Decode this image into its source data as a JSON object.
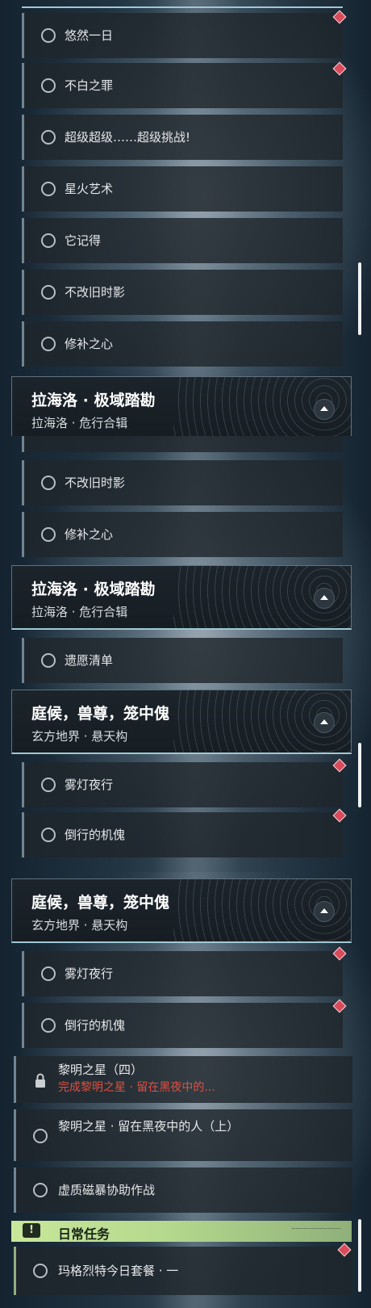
{
  "panel1": {
    "items": [
      "悠然一日",
      "不白之罪",
      "超级超级……超级挑战!",
      "星火艺术",
      "它记得",
      "不改旧时影",
      "修补之心"
    ],
    "header": {
      "title": "拉海洛 · 极域踏勘",
      "subtitle": "拉海洛 · 危行合辑"
    }
  },
  "panel2": {
    "items_top": [
      "不改旧时影",
      "修补之心"
    ],
    "header1": {
      "title": "拉海洛 · 极域踏勘",
      "subtitle": "拉海洛 · 危行合辑"
    },
    "item_mid": "遗愿清单",
    "header2": {
      "title": "庭候，兽尊，笼中傀",
      "subtitle": "玄方地界 · 悬天构"
    },
    "items_bottom": [
      "雾灯夜行",
      "倒行的机傀"
    ]
  },
  "panel3": {
    "header": {
      "title": "庭候，兽尊，笼中傀",
      "subtitle": "玄方地界 · 悬天构"
    },
    "items": [
      "雾灯夜行",
      "倒行的机傀"
    ],
    "locked_item": {
      "title": "黎明之星（四）",
      "requirement": "完成黎明之星 · 留在黑夜中的..."
    },
    "quest_long": "黎明之星 · 留在黑夜中的人（上）",
    "quest_short": "虚质磁暴协助作战",
    "daily": {
      "badge": "!",
      "label": "日常任务"
    },
    "daily_item": "玛格烈特今日套餐 · 一"
  },
  "colors": {
    "accent_daily": "#c8e79a",
    "marker": "#d94b5a",
    "warning_text": "#e04f3f"
  }
}
